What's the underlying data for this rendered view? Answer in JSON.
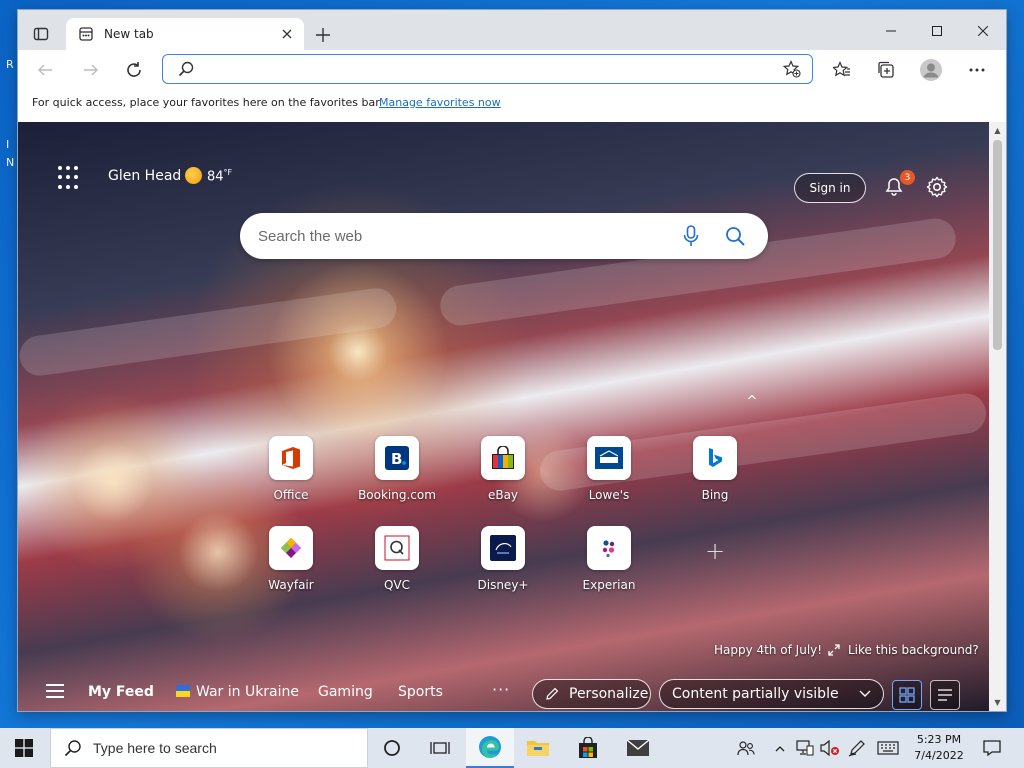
{
  "desktop": {
    "fragments": [
      "R",
      "I",
      "N"
    ]
  },
  "browser": {
    "tab": {
      "title": "New tab"
    },
    "address": {
      "value": "",
      "placeholder": ""
    },
    "favorites_bar": {
      "message": "For quick access, place your favorites here on the favorites bar.",
      "link": "Manage favorites now"
    }
  },
  "newtab": {
    "location": "Glen Head",
    "temperature": "84",
    "temperature_unit": "°F",
    "sign_in": "Sign in",
    "notification_count": "3",
    "search_placeholder": "Search the web",
    "collapse_glyph": "^",
    "add_tile_glyph": "+",
    "quick_links": [
      {
        "label": "Office",
        "icon": "office-icon",
        "color": "#d83b01"
      },
      {
        "label": "Booking.com",
        "icon": "booking-icon",
        "color": "#003580"
      },
      {
        "label": "eBay",
        "icon": "ebay-icon",
        "color": "#e53238"
      },
      {
        "label": "Lowe's",
        "icon": "lowes-icon",
        "color": "#004990"
      },
      {
        "label": "Bing",
        "icon": "bing-icon",
        "color": "#0078d4"
      },
      {
        "label": "Wayfair",
        "icon": "wayfair-icon",
        "color": "#7f187f"
      },
      {
        "label": "QVC",
        "icon": "qvc-icon",
        "color": "#c8102e"
      },
      {
        "label": "Disney+",
        "icon": "disney-plus-icon",
        "color": "#0b1a4d"
      },
      {
        "label": "Experian",
        "icon": "experian-icon",
        "color": "#6d2077"
      }
    ],
    "background_caption": "Happy 4th of July!",
    "like_background": "Like this background?",
    "feed": {
      "my_feed": "My Feed",
      "items": [
        "War in Ukraine",
        "Gaming",
        "Sports"
      ],
      "more": "···",
      "personalize": "Personalize",
      "content_visibility": "Content partially visible"
    }
  },
  "taskbar": {
    "search_placeholder": "Type here to search",
    "time": "5:23 PM",
    "date": "7/4/2022"
  },
  "colors": {
    "accent": "#3a86e6",
    "link": "#1a6fc4",
    "badge": "#e8572a",
    "taskbar": "#dfe5ee"
  }
}
